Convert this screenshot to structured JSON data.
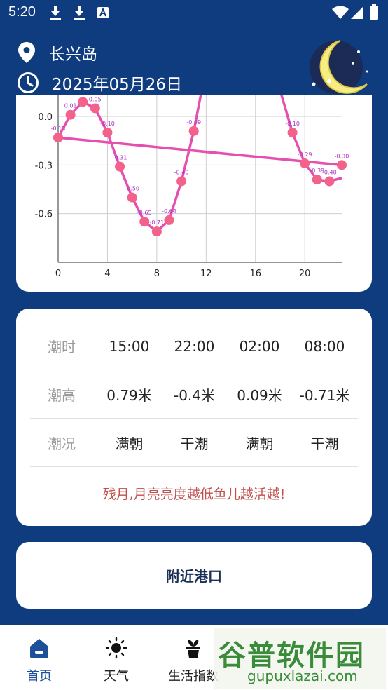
{
  "status_bar": {
    "time": "5:20",
    "left_icons": [
      "download-icon",
      "download-icon",
      "text-notification-icon"
    ],
    "right_icons": [
      "wifi-icon",
      "signal-icon",
      "battery-icon"
    ]
  },
  "header": {
    "location": "长兴岛",
    "date": "2025年05月26日",
    "moon_icon": "crescent-moon-icon"
  },
  "chart_data": {
    "type": "line",
    "x_ticks": [
      "0",
      "4",
      "8",
      "12",
      "16",
      "20"
    ],
    "y_ticks": [
      "0.0",
      "-0.3",
      "-0.6"
    ],
    "xlim": [
      0,
      23
    ],
    "ylim": [
      -0.9,
      0.13
    ],
    "grid": true,
    "series": [
      {
        "color": "#e44fb0",
        "points": [
          {
            "x": 0,
            "y": -0.13,
            "label": "-0.13"
          },
          {
            "x": 1,
            "y": 0.01,
            "label": "0.01"
          },
          {
            "x": 2,
            "y": 0.09,
            "label": "0.09"
          },
          {
            "x": 3,
            "y": 0.05,
            "label": "0.05"
          },
          {
            "x": 4,
            "y": -0.1,
            "label": "-0.10"
          },
          {
            "x": 5,
            "y": -0.31,
            "label": "-0.31"
          },
          {
            "x": 6,
            "y": -0.5,
            "label": "-0.50"
          },
          {
            "x": 7,
            "y": -0.65,
            "label": "-0.65"
          },
          {
            "x": 8,
            "y": -0.71,
            "label": "-0.71"
          },
          {
            "x": 9,
            "y": -0.64,
            "label": "-0.64"
          },
          {
            "x": 10,
            "y": -0.4,
            "label": "-0.40"
          },
          {
            "x": 11,
            "y": -0.09,
            "label": "-0.09"
          },
          {
            "x": 12,
            "y": 0.3,
            "label": ""
          },
          {
            "x": 18,
            "y": 0.16,
            "label": ""
          },
          {
            "x": 19,
            "y": -0.1,
            "label": "-0.10"
          },
          {
            "x": 20,
            "y": -0.29,
            "label": "-0.29"
          },
          {
            "x": 21,
            "y": -0.39,
            "label": "-0.39"
          },
          {
            "x": 22,
            "y": -0.4,
            "label": "-0.40"
          },
          {
            "x": 23,
            "y": -0.38,
            "label": ""
          }
        ]
      },
      {
        "color": "#e44fb0",
        "points": [
          {
            "x": 0,
            "y": -0.13,
            "label": ""
          },
          {
            "x": 23,
            "y": -0.3,
            "label": "-0.30"
          }
        ]
      }
    ]
  },
  "tide_table": {
    "rows": [
      {
        "label": "潮时",
        "values": [
          "15:00",
          "22:00",
          "02:00",
          "08:00"
        ]
      },
      {
        "label": "潮高",
        "values": [
          "0.79米",
          "-0.4米",
          "0.09米",
          "-0.71米"
        ]
      },
      {
        "label": "潮况",
        "values": [
          "满朝",
          "干潮",
          "满朝",
          "干潮"
        ]
      }
    ],
    "tip": "残月,月亮亮度越低鱼儿越活越!"
  },
  "nearby_port": {
    "label": "附近港口"
  },
  "tabs": [
    {
      "label": "首页",
      "icon": "home-icon",
      "active": true
    },
    {
      "label": "天气",
      "icon": "sun-icon",
      "active": false
    },
    {
      "label": "生活指数",
      "icon": "plant-pot-icon",
      "active": false
    },
    {
      "label": "",
      "icon": "",
      "active": false
    },
    {
      "label": "",
      "icon": "",
      "active": false
    }
  ],
  "watermark": {
    "main": "谷普软件园",
    "sub": "gupuxlazai.com"
  },
  "colors": {
    "background": "#0f3c7e",
    "accent": "#1d4f9a",
    "tip": "#c0504d",
    "series": "#e44fb0",
    "marker": "#f2628a"
  }
}
